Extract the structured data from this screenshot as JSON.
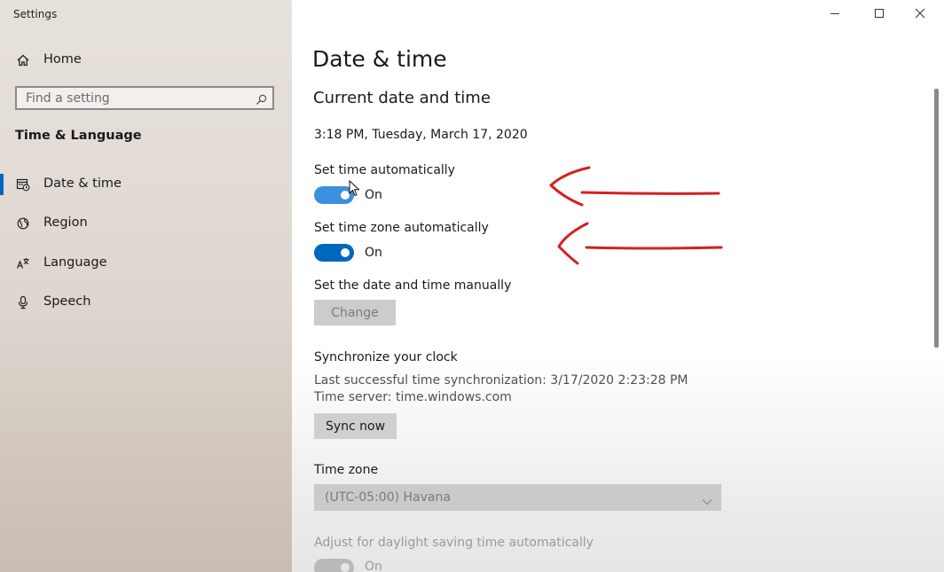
{
  "window": {
    "app_title": "Settings",
    "minimize_icon": "minimize-icon",
    "maximize_icon": "maximize-icon",
    "close_icon": "close-icon"
  },
  "sidebar": {
    "home": {
      "label": "Home",
      "icon": "home-icon"
    },
    "search": {
      "placeholder": "Find a setting",
      "value": "",
      "icon": "search-icon"
    },
    "section_title": "Time & Language",
    "items": [
      {
        "label": "Date & time",
        "icon": "calendar-clock-icon",
        "selected": true
      },
      {
        "label": "Region",
        "icon": "globe-icon",
        "selected": false
      },
      {
        "label": "Language",
        "icon": "language-icon",
        "selected": false
      },
      {
        "label": "Speech",
        "icon": "microphone-icon",
        "selected": false
      }
    ]
  },
  "main": {
    "page_title": "Date & time",
    "current_heading": "Current date and time",
    "current_datetime": "3:18 PM, Tuesday, March 17, 2020",
    "set_time_auto": {
      "label": "Set time automatically",
      "state": "On",
      "on": true
    },
    "set_timezone_auto": {
      "label": "Set time zone automatically",
      "state": "On",
      "on": true
    },
    "manual": {
      "label": "Set the date and time manually",
      "button": "Change",
      "enabled": false
    },
    "sync": {
      "heading": "Synchronize your clock",
      "last_sync": "Last successful time synchronization: 3/17/2020 2:23:28 PM",
      "server": "Time server: time.windows.com",
      "button": "Sync now"
    },
    "timezone": {
      "label": "Time zone",
      "value": "(UTC-05:00) Havana",
      "enabled": false
    },
    "dst": {
      "label": "Adjust for daylight saving time automatically",
      "state": "On",
      "enabled": false
    }
  },
  "colors": {
    "accent": "#0067c0",
    "annotation": "#d42020"
  }
}
